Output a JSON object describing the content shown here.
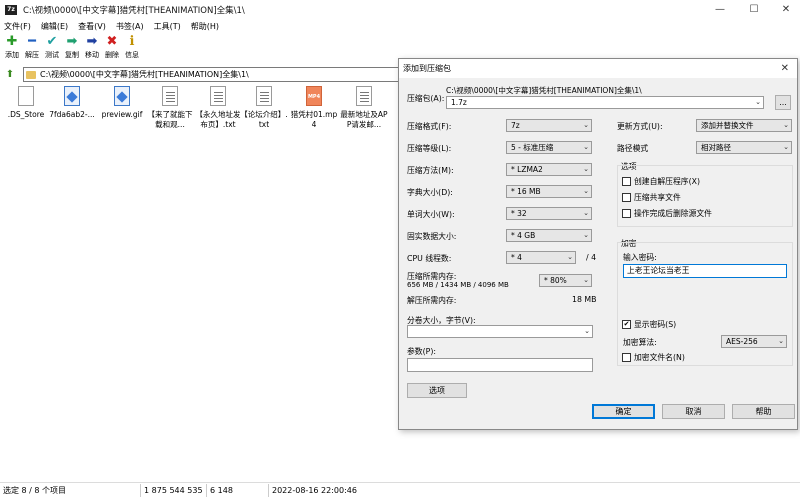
{
  "window": {
    "title": "C:\\视频\\0000\\[中文字幕]猎凭村[THEANIMATION]全集\\1\\",
    "minimize": "—",
    "maximize": "☐",
    "close": "✕"
  },
  "menu": [
    "文件(F)",
    "编辑(E)",
    "查看(V)",
    "书签(A)",
    "工具(T)",
    "帮助(H)"
  ],
  "toolbar": [
    {
      "label": "添加",
      "icon": "add-icon",
      "glyph": "✚",
      "color": "#2a9a2a"
    },
    {
      "label": "解压",
      "icon": "extract-icon",
      "glyph": "━",
      "color": "#2060c0"
    },
    {
      "label": "测试",
      "icon": "test-icon",
      "glyph": "✔",
      "color": "#20a0a0"
    },
    {
      "label": "复制",
      "icon": "copy-icon",
      "glyph": "➡",
      "color": "#20a070"
    },
    {
      "label": "移动",
      "icon": "move-icon",
      "glyph": "➡",
      "color": "#2040a0"
    },
    {
      "label": "删除",
      "icon": "delete-icon",
      "glyph": "✖",
      "color": "#d02020"
    },
    {
      "label": "信息",
      "icon": "info-icon",
      "glyph": "ℹ",
      "color": "#c09000"
    }
  ],
  "address": "C:\\视频\\0000\\[中文字幕]猎凭村[THEANIMATION]全集\\1\\",
  "files": [
    {
      "name": ".DS_Store",
      "type": "blank"
    },
    {
      "name": "7fda6ab2-...",
      "type": "img"
    },
    {
      "name": "preview.gif",
      "type": "img"
    },
    {
      "name": "【来了就能下载和观...",
      "type": "txt"
    },
    {
      "name": "【永久地址发布页】.txt",
      "type": "txt"
    },
    {
      "name": "【论坛介绍】.txt",
      "type": "txt"
    },
    {
      "name": "猎凭村01.mp4",
      "type": "mp4"
    },
    {
      "name": "最新地址及APP请发邮...",
      "type": "txt"
    }
  ],
  "status": {
    "selection": "选定 8 / 8 个项目",
    "total_size": "1 875 544 535",
    "sel_size": "6 148",
    "modified": "2022-08-16 22:00:46"
  },
  "dialog": {
    "title": "添加到压缩包",
    "archive_label": "压缩包(A):",
    "archive_dir": "C:\\视频\\0000\\[中文字幕]猎凭村[THEANIMATION]全集\\1\\",
    "archive_name": "1.7z",
    "browse": "...",
    "format_label": "压缩格式(F):",
    "format": "7z",
    "level_label": "压缩等级(L):",
    "level": "5 - 标准压缩",
    "method_label": "压缩方法(M):",
    "method": "* LZMA2",
    "dict_label": "字典大小(D):",
    "dict": "* 16 MB",
    "word_label": "单词大小(W):",
    "word": "* 32",
    "solid_label": "固实数据大小:",
    "solid": "* 4 GB",
    "cpu_label": "CPU 线程数:",
    "cpu": "* 4",
    "cpu_total": "/ 4",
    "mem_label": "压缩所需内存:",
    "mem_values": "656 MB / 1434 MB / 4096 MB",
    "mem_pct": "* 80%",
    "dmem_label": "解压所需内存:",
    "dmem": "18 MB",
    "split_label": "分卷大小，字节(V):",
    "params_label": "参数(P):",
    "options_btn": "选项",
    "update_label": "更新方式(U):",
    "update": "添加并替换文件",
    "path_label": "路径模式",
    "path_mode": "相对路径",
    "opts_title": "选项",
    "opt_sfx": "创建自解压程序(X)",
    "opt_shared": "压缩共享文件",
    "opt_delete": "操作完成后删除源文件",
    "enc_title": "加密",
    "pwd_label": "输入密码:",
    "password": "上老王论坛当老王",
    "show_pwd": "显示密码(S)",
    "enc_method_label": "加密算法:",
    "enc_method": "AES-256",
    "enc_names": "加密文件名(N)",
    "ok": "确定",
    "cancel": "取消",
    "help": "帮助"
  }
}
